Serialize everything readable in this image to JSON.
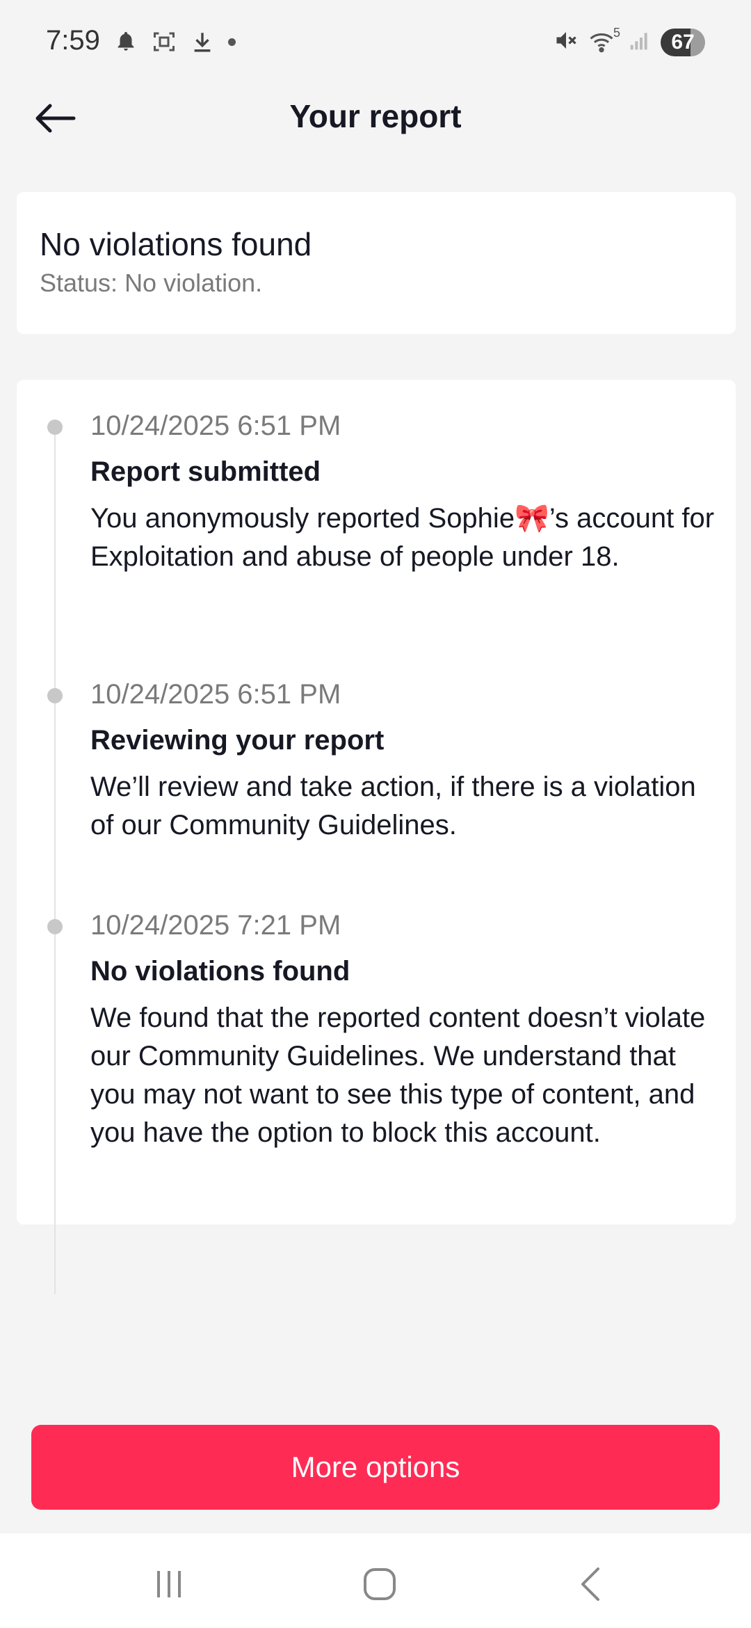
{
  "status_bar": {
    "time": "7:59",
    "battery": "67",
    "battery_level": 0.67,
    "wifi_label": "5",
    "left_icons": [
      "bell-icon",
      "screenshot-icon",
      "download-icon",
      "dot-icon"
    ],
    "right_icons": [
      "mute-icon",
      "wifi-icon",
      "signal-icon",
      "battery-icon"
    ]
  },
  "header": {
    "title": "Your report",
    "back_icon": "arrow-left-icon"
  },
  "status_card": {
    "title": "No violations found",
    "subtitle": "Status: No violation."
  },
  "timeline": [
    {
      "date": "10/24/2025 6:51 PM",
      "heading": "Report submitted",
      "body": "You anonymously reported Sophie🎀’s account for Exploitation and abuse of people under 18."
    },
    {
      "date": "10/24/2025 6:51 PM",
      "heading": "Reviewing your report",
      "body": "We’ll review and take action, if there is a violation of our Community Guidelines."
    },
    {
      "date": "10/24/2025 7:21 PM",
      "heading": "No violations found",
      "body": "We found that the reported content doesn’t violate our Community Guidelines. We understand that you may not want to see this type of content, and you have the option to block this account."
    }
  ],
  "actions": {
    "more_options": "More options"
  },
  "nav_bar": {
    "icons": [
      "recents-icon",
      "home-icon",
      "back-icon"
    ]
  },
  "colors": {
    "accent": "#fe2c55",
    "background": "#f4f4f4",
    "card": "#ffffff",
    "muted_text": "#7a7a7a"
  }
}
